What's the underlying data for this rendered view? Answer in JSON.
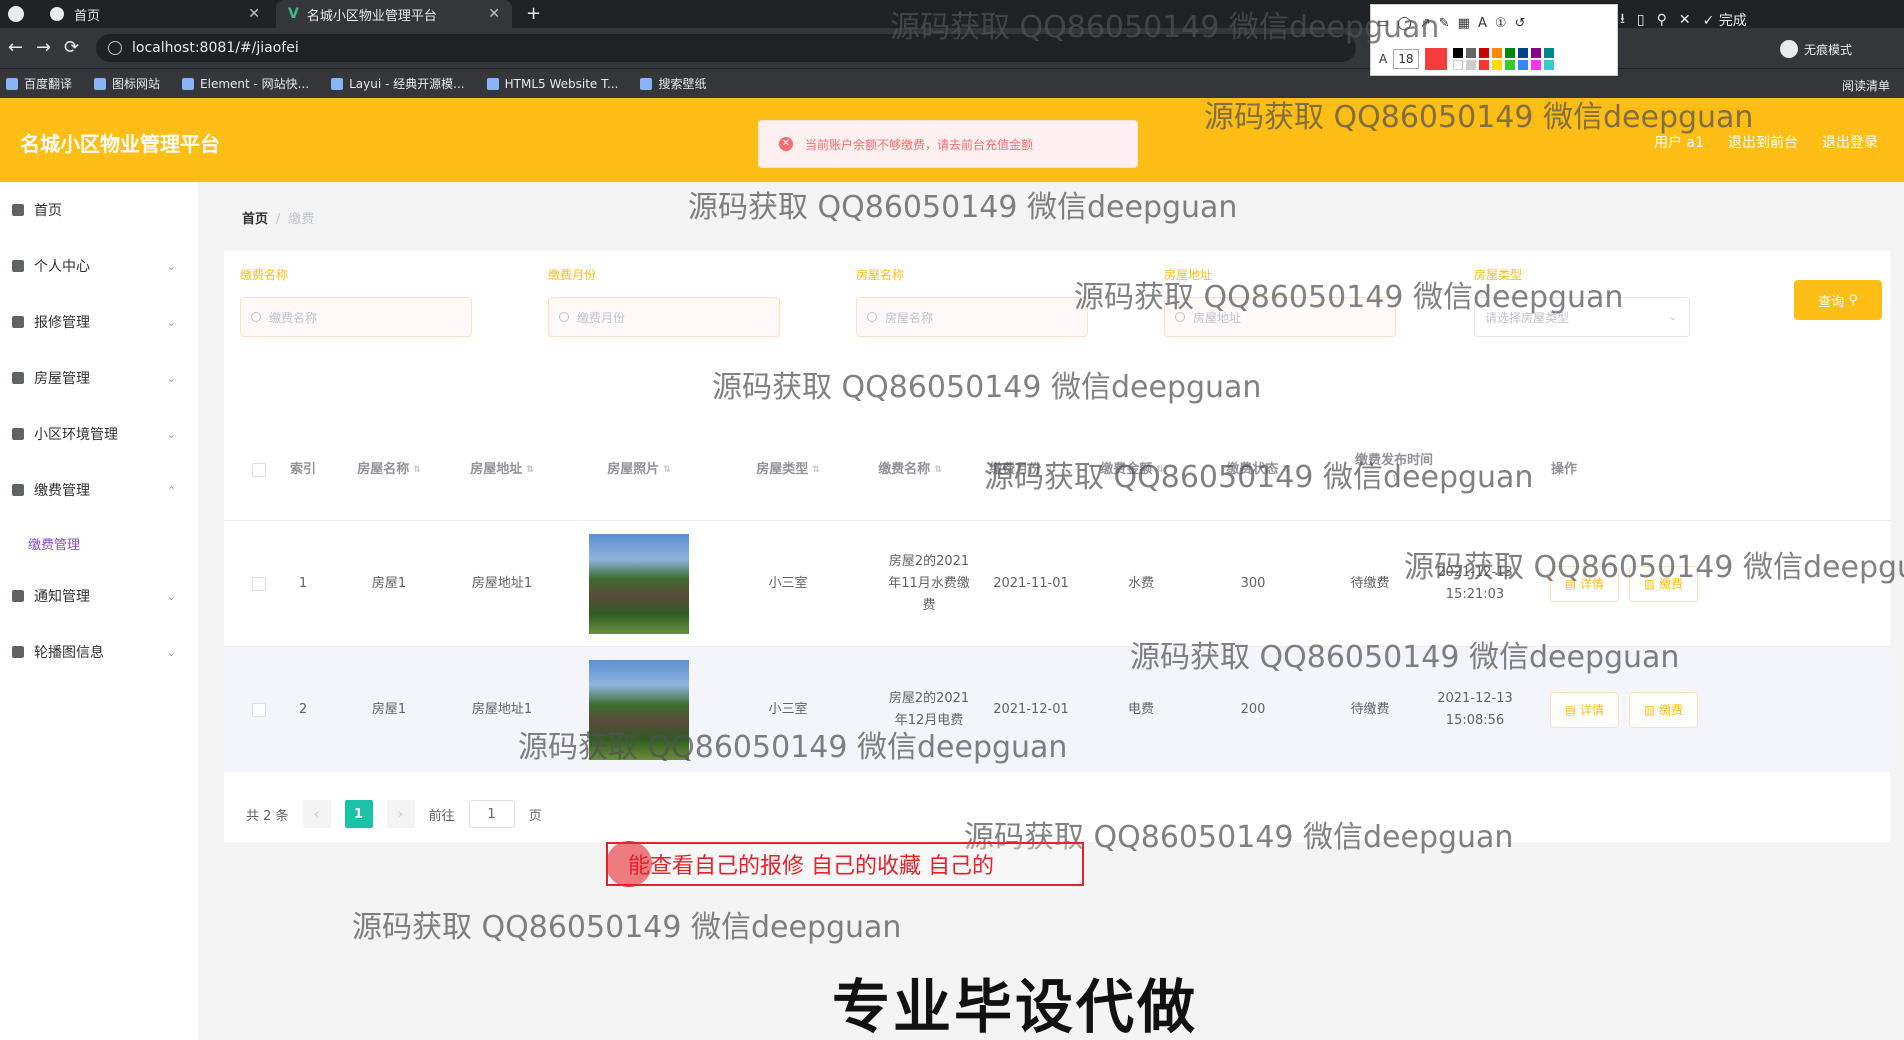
{
  "browser": {
    "tabs": [
      {
        "title": "首页"
      },
      {
        "title": "名城小区物业管理平台"
      }
    ],
    "url": "localhost:8081/#/jiaofei",
    "incognito": "无痕模式",
    "bookmarks": [
      "百度翻译",
      "图标网站",
      "Element - 网站快...",
      "Layui - 经典开源模...",
      "HTML5 Website T...",
      "搜索壁纸"
    ],
    "reading_list": "阅读清单",
    "annot_font_size": "18",
    "annot_done": "完成"
  },
  "header": {
    "title": "名城小区物业管理平台",
    "links": [
      "用户 a1",
      "退出到前台",
      "退出登录"
    ],
    "toast": "当前账户余额不够缴费，请去前台充值金额"
  },
  "sidebar": {
    "items": [
      {
        "label": "首页",
        "chevron": ""
      },
      {
        "label": "个人中心",
        "chevron": "⌄"
      },
      {
        "label": "报修管理",
        "chevron": "⌄"
      },
      {
        "label": "房屋管理",
        "chevron": "⌄"
      },
      {
        "label": "小区环境管理",
        "chevron": "⌄"
      },
      {
        "label": "缴费管理",
        "chevron": "⌃"
      },
      {
        "label": "通知管理",
        "chevron": "⌄"
      },
      {
        "label": "轮播图信息",
        "chevron": "⌄"
      }
    ],
    "sub_item": "缴费管理"
  },
  "breadcrumb": {
    "home": "首页",
    "current": "缴费"
  },
  "search": {
    "fields": [
      {
        "label": "缴费名称",
        "placeholder": "缴费名称"
      },
      {
        "label": "缴费月份",
        "placeholder": "缴费月份"
      },
      {
        "label": "房屋名称",
        "placeholder": "房屋名称"
      },
      {
        "label": "房屋地址",
        "placeholder": "房屋地址"
      }
    ],
    "type_label": "房屋类型",
    "type_placeholder": "请选择房屋类型",
    "query_button": "查询"
  },
  "table": {
    "headers": [
      "索引",
      "房屋名称",
      "房屋地址",
      "房屋照片",
      "房屋类型",
      "缴费名称",
      "缴费月份",
      "缴费金额",
      "缴费状态",
      "缴费发布时间",
      "操作"
    ],
    "rows": [
      {
        "index": "1",
        "house_name": "房屋1",
        "address": "房屋地址1",
        "type": "小三室",
        "fee_name": "房屋2的2021年11月水费缴费",
        "month": "2021-11-01",
        "fee_type": "水费",
        "amount": "300",
        "status": "待缴费",
        "time": "2021-12-13 15:21:03"
      },
      {
        "index": "2",
        "house_name": "房屋1",
        "address": "房屋地址1",
        "type": "小三室",
        "fee_name": "房屋2的2021年12月电费",
        "month": "2021-12-01",
        "fee_type": "电费",
        "amount": "200",
        "status": "待缴费",
        "time": "2021-12-13 15:08:56"
      }
    ],
    "detail_button": "详情",
    "pay_button": "缴费"
  },
  "pagination": {
    "total": "共 2 条",
    "current": "1",
    "goto": "前往",
    "page_value": "1",
    "page_unit": "页"
  },
  "overlay": {
    "watermark": "源码获取 QQ86050149 微信deepguan",
    "annotation": "能查看自己的报修 自己的收藏 自己的",
    "caption": "专业毕设代做"
  }
}
